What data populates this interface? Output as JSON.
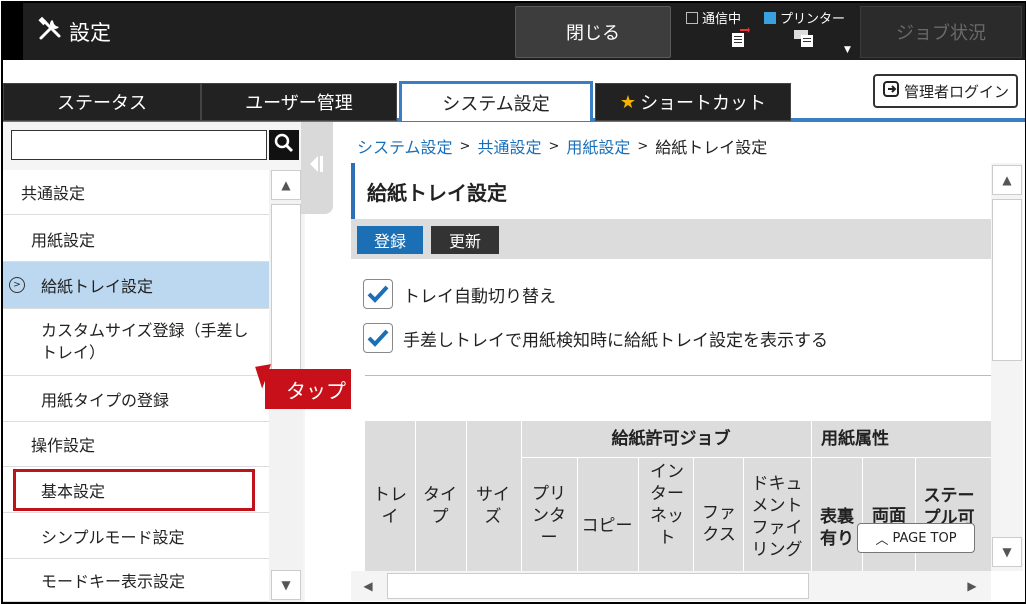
{
  "app": {
    "title": "設定"
  },
  "topbar": {
    "close_label": "閉じる",
    "status_comm_label": "通信中",
    "status_printer_label": "プリンター",
    "job_status_label": "ジョブ状況"
  },
  "tabs": [
    {
      "label": "ステータス",
      "active": false
    },
    {
      "label": "ユーザー管理",
      "active": false
    },
    {
      "label": "システム設定",
      "active": true
    },
    {
      "label": "ショートカット",
      "active": false
    }
  ],
  "admin_login_label": "管理者ログイン",
  "search": {
    "value": "",
    "placeholder": ""
  },
  "sidebar": {
    "items": [
      {
        "label": "共通設定"
      },
      {
        "label": "用紙設定"
      },
      {
        "label": "給紙トレイ設定",
        "selected": true
      },
      {
        "label": "カスタムサイズ登録（手差しトレイ）"
      },
      {
        "label": "用紙タイプの登録"
      },
      {
        "label": "操作設定"
      },
      {
        "label": "基本設定"
      },
      {
        "label": "シンプルモード設定"
      },
      {
        "label": "モードキー表示設定"
      }
    ]
  },
  "callout": {
    "label": "タップ"
  },
  "breadcrumb": {
    "items": [
      "システム設定",
      "共通設定",
      "用紙設定",
      "給紙トレイ設定"
    ],
    "separator": ">"
  },
  "page": {
    "title": "給紙トレイ設定",
    "register_label": "登録",
    "update_label": "更新"
  },
  "options": [
    {
      "label": "トレイ自動切り替え",
      "checked": true
    },
    {
      "label": "手差しトレイで用紙検知時に給紙トレイ設定を表示する",
      "checked": true
    }
  ],
  "table": {
    "group_headers": {
      "allowed_jobs": "給紙許可ジョブ",
      "paper_attr": "用紙属性"
    },
    "columns": {
      "tray": "トレイ",
      "type": "タイプ",
      "size": "サイズ",
      "printer": "プリンター",
      "copy": "コピー",
      "internet": "インターネット",
      "fax": "ファクス",
      "doc_filing": "ドキュメントファイリング",
      "front_back": "表裏有り",
      "duplex": "両面",
      "staple": "ステープル可"
    }
  },
  "page_top_label": "PAGE TOP"
}
